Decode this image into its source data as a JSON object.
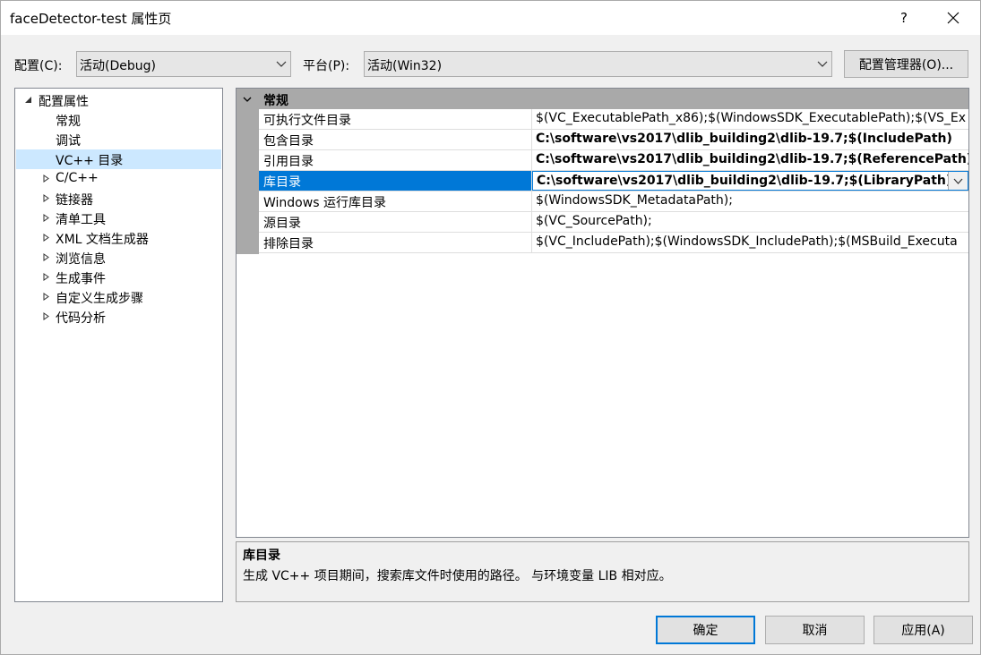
{
  "window": {
    "title": "faceDetector-test 属性页",
    "help_label": "?"
  },
  "config": {
    "label": "配置(C):",
    "value": "活动(Debug)"
  },
  "platform": {
    "label": "平台(P):",
    "value": "活动(Win32)"
  },
  "config_manager_label": "配置管理器(O)...",
  "tree": {
    "root": "配置属性",
    "items": [
      {
        "label": "常规"
      },
      {
        "label": "调试"
      },
      {
        "label": "VC++ 目录"
      },
      {
        "label": "C/C++"
      },
      {
        "label": "链接器"
      },
      {
        "label": "清单工具"
      },
      {
        "label": "XML 文档生成器"
      },
      {
        "label": "浏览信息"
      },
      {
        "label": "生成事件"
      },
      {
        "label": "自定义生成步骤"
      },
      {
        "label": "代码分析"
      }
    ]
  },
  "grid": {
    "category": "常规",
    "rows": [
      {
        "name": "可执行文件目录",
        "value": "$(VC_ExecutablePath_x86);$(WindowsSDK_ExecutablePath);$(VS_Ex"
      },
      {
        "name": "包含目录",
        "value": "C:\\software\\vs2017\\dlib_building2\\dlib-19.7;$(IncludePath)"
      },
      {
        "name": "引用目录",
        "value": "C:\\software\\vs2017\\dlib_building2\\dlib-19.7;$(ReferencePath)"
      },
      {
        "name": "库目录",
        "value": "C:\\software\\vs2017\\dlib_building2\\dlib-19.7;$(LibraryPath)"
      },
      {
        "name": "Windows 运行库目录",
        "value": "$(WindowsSDK_MetadataPath);"
      },
      {
        "name": "源目录",
        "value": "$(VC_SourcePath);"
      },
      {
        "name": "排除目录",
        "value": "$(VC_IncludePath);$(WindowsSDK_IncludePath);$(MSBuild_Executa"
      }
    ]
  },
  "description": {
    "title": "库目录",
    "text": "生成 VC++ 项目期间，搜索库文件时使用的路径。 与环境变量 LIB 相对应。"
  },
  "buttons": {
    "ok": "确定",
    "cancel": "取消",
    "apply": "应用(A)"
  },
  "colors": {
    "accent": "#0078d7",
    "selection_light": "#cce8ff",
    "category_bar": "#a9a9a9"
  }
}
